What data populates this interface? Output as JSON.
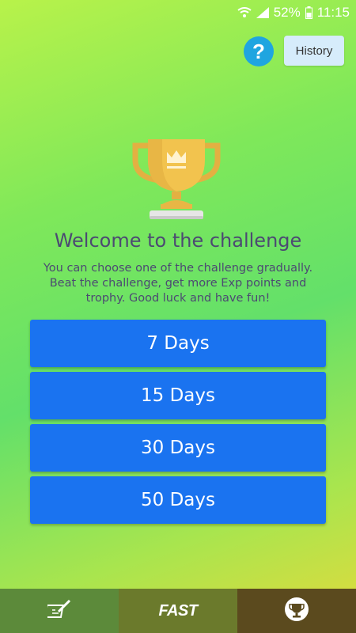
{
  "status_bar": {
    "battery_percent": "52%",
    "time": "11:15"
  },
  "header": {
    "help_label": "?",
    "history_label": "History"
  },
  "welcome": {
    "title": "Welcome to the challenge",
    "description": "You can choose one of the challenge gradually. Beat the challenge, get more Exp points and trophy. Good luck and have fun!"
  },
  "challenges": [
    {
      "label": "7 Days"
    },
    {
      "label": "15 Days"
    },
    {
      "label": "30 Days"
    },
    {
      "label": "50 Days"
    }
  ],
  "bottom_nav": {
    "tabs": [
      {
        "icon": "write-icon"
      },
      {
        "label": "FAST"
      },
      {
        "icon": "trophy-icon"
      }
    ]
  },
  "colors": {
    "accent_blue": "#1a73f0",
    "title_text": "#4c4a72",
    "help_blue": "#1fa5e0",
    "trophy_gold": "#f2c34e"
  }
}
